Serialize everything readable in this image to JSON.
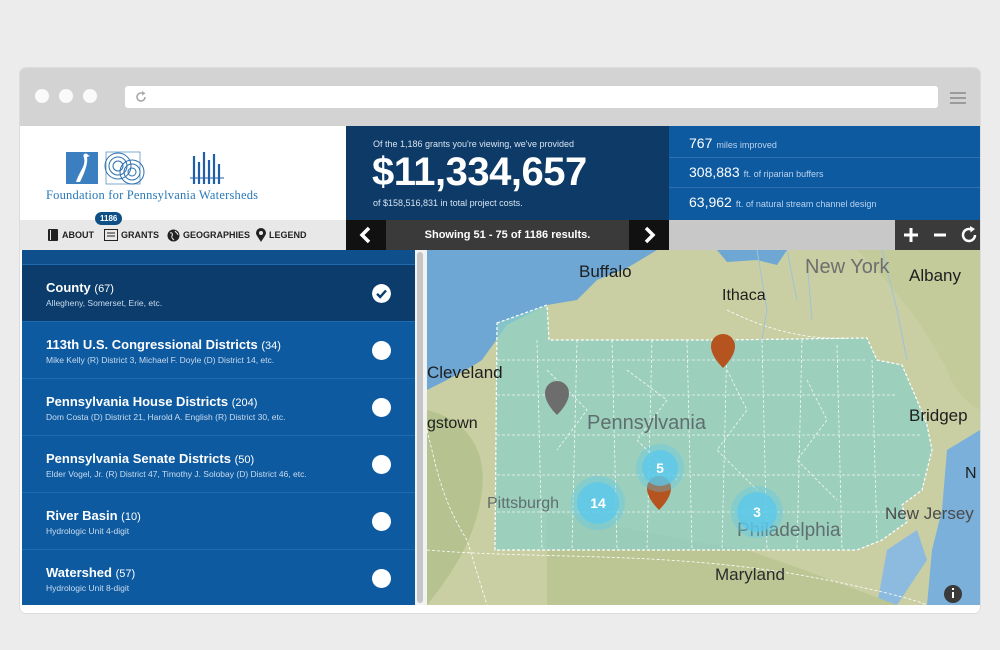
{
  "app": {
    "brand_name": "Foundation for Pennsylvania Watersheds",
    "nav": [
      {
        "label": "ABOUT",
        "icon": "book-icon"
      },
      {
        "label": "GRANTS",
        "icon": "grants-icon",
        "badge": "1186"
      },
      {
        "label": "GEOGRAPHIES",
        "icon": "globe-icon"
      },
      {
        "label": "LEGEND",
        "icon": "map-pin-icon"
      }
    ]
  },
  "hero": {
    "top_text": "Of the 1,186 grants you're viewing, we've provided",
    "amount": "$11,334,657",
    "bottom_text": "of $158,516,831 in total project costs."
  },
  "stats": [
    {
      "value": "767",
      "label": "miles improved"
    },
    {
      "value": "308,883",
      "label": "ft. of riparian buffers"
    },
    {
      "value": "63,962",
      "label": "ft. of natural stream channel design"
    }
  ],
  "pager": {
    "text": "Showing 51 - 75 of 1186 results."
  },
  "geographies": [
    {
      "title": "County",
      "count": "(67)",
      "sub": "Allegheny, Somerset, Erie, etc.",
      "selected": true
    },
    {
      "title": "113th U.S. Congressional Districts",
      "count": "(34)",
      "sub": "Mike Kelly (R) District 3, Michael F. Doyle (D) District 14, etc.",
      "selected": false
    },
    {
      "title": "Pennsylvania House Districts",
      "count": "(204)",
      "sub": "Dom Costa (D) District 21, Harold A. English (R) District 30, etc.",
      "selected": false
    },
    {
      "title": "Pennsylvania Senate Districts",
      "count": "(50)",
      "sub": "Elder Vogel, Jr. (R) District 47, Timothy J. Solobay (D) District 46, etc.",
      "selected": false
    },
    {
      "title": "River Basin",
      "count": "(10)",
      "sub": "Hydrologic Unit 4-digit",
      "selected": false
    },
    {
      "title": "Watershed",
      "count": "(57)",
      "sub": "Hydrologic Unit 8-digit",
      "selected": false
    }
  ],
  "map": {
    "labels": {
      "buffalo": "Buffalo",
      "ithaca": "Ithaca",
      "new_york": "New York",
      "albany": "Albany",
      "cleveland": "Cleveland",
      "youngstown": "gstown",
      "pennsylvania": "Pennsylvania",
      "bridgeport": "Bridgep",
      "pittsburgh": "Pittsburgh",
      "philadelphia": "Philadelphia",
      "new_jersey": "New Jersey",
      "maryland": "Maryland",
      "edge_n": "N"
    },
    "clusters": [
      "5",
      "14",
      "3"
    ]
  },
  "colors": {
    "hero_bg": "#0d3a66",
    "stats_bg": "#0e5aa0",
    "list_bg": "#0e5aa0",
    "list_selected": "#0b3c6b",
    "marker_orange": "#b5541f",
    "marker_gray": "#6d6d6d",
    "cluster": "#5ac8eb"
  }
}
